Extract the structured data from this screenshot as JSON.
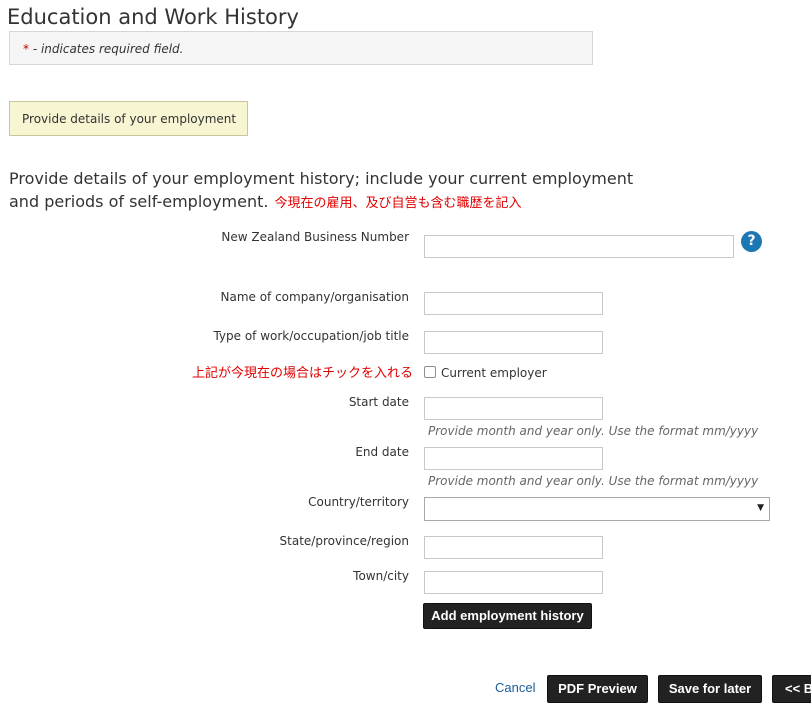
{
  "page": {
    "title": "Education and Work History"
  },
  "notice": {
    "star": "*",
    "text": " - indicates required field."
  },
  "section_tab": {
    "label": "Provide details of your employment"
  },
  "intro": {
    "line1": "Provide details of your employment history; include your current employment",
    "line2": "and periods of self-employment.",
    "jp_note": "今現在の雇用、及び自営も含む職歴を記入"
  },
  "form": {
    "nzbn_label": "New Zealand Business Number",
    "nzbn_value": "",
    "help_icon_glyph": "?",
    "company_label": "Name of company/organisation",
    "company_value": "",
    "job_label": "Type of work/occupation/job title",
    "job_value": "",
    "current_jp_note": "上記が今現在の場合はチックを入れる",
    "current_employer_label": "Current employer",
    "current_employer_checked": false,
    "start_label": "Start date",
    "start_value": "",
    "start_hint": "Provide month and year only. Use the format mm/yyyy",
    "end_label": "End date",
    "end_value": "",
    "end_hint": "Provide month and year only. Use the format mm/yyyy",
    "country_label": "Country/territory",
    "country_value": "",
    "state_label": "State/province/region",
    "state_value": "",
    "town_label": "Town/city",
    "town_value": "",
    "add_button": "Add employment history"
  },
  "footer": {
    "cancel": "Cancel",
    "pdf_preview": "PDF Preview",
    "save_later": "Save for later",
    "back": "<< B"
  },
  "colors": {
    "accent_red": "#e00000",
    "tab_bg": "#f7f5d2",
    "button_bg": "#222222",
    "link_blue": "#1a5e99",
    "help_blue": "#1c77b5"
  }
}
